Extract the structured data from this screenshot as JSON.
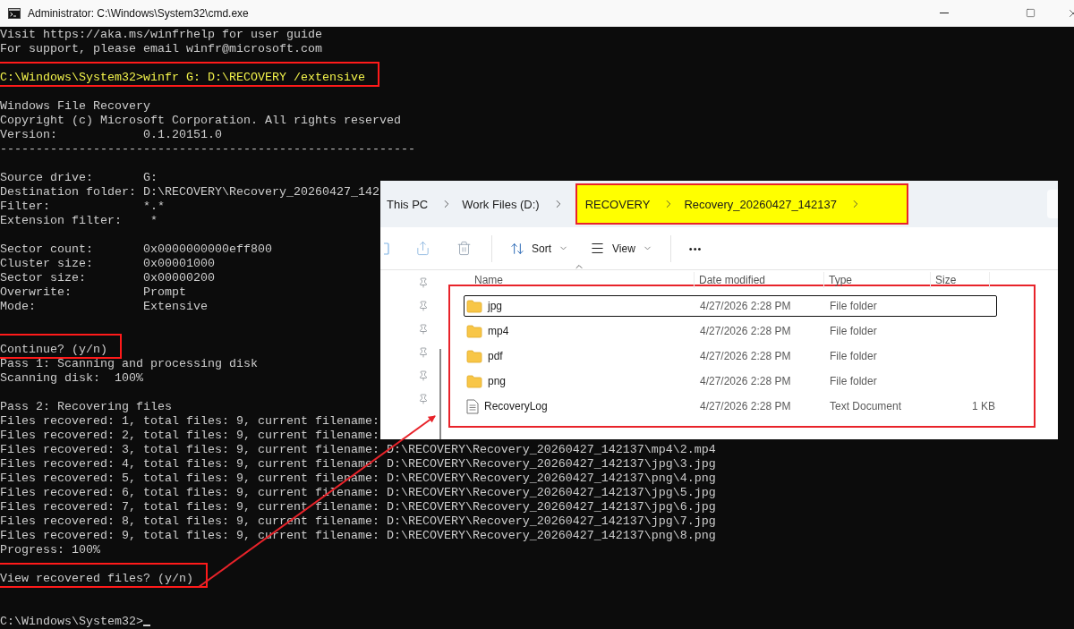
{
  "window": {
    "title": "Administrator: C:\\Windows\\System32\\cmd.exe"
  },
  "terminal": {
    "lines": [
      {
        "kind": "output",
        "text": "Visit https://aka.ms/winfrhelp for user guide",
        "boxed": false
      },
      {
        "kind": "output",
        "text": "For support, please email winfr@microsoft.com",
        "boxed": false
      },
      {
        "kind": "blank"
      },
      {
        "kind": "command",
        "text": "C:\\Windows\\System32>winfr G: D:\\RECOVERY /extensive",
        "boxed": true
      },
      {
        "kind": "blank"
      },
      {
        "kind": "output",
        "text": "Windows File Recovery",
        "boxed": false
      },
      {
        "kind": "output",
        "text": "Copyright (c) Microsoft Corporation. All rights reserved",
        "boxed": false
      },
      {
        "kind": "output",
        "text": "Version:            0.1.20151.0",
        "boxed": false
      },
      {
        "kind": "output",
        "text": "----------------------------------------------------------",
        "boxed": false
      },
      {
        "kind": "blank"
      },
      {
        "kind": "output",
        "text": "Source drive:       G:",
        "boxed": false
      },
      {
        "kind": "output",
        "text": "Destination folder: D:\\RECOVERY\\Recovery_20260427_142",
        "boxed": false
      },
      {
        "kind": "output",
        "text": "Filter:             *.*",
        "boxed": false
      },
      {
        "kind": "output",
        "text": "Extension filter:    *",
        "boxed": false
      },
      {
        "kind": "blank"
      },
      {
        "kind": "output",
        "text": "Sector count:       0x0000000000eff800",
        "boxed": false
      },
      {
        "kind": "output",
        "text": "Cluster size:       0x00001000",
        "boxed": false
      },
      {
        "kind": "output",
        "text": "Sector size:        0x00000200",
        "boxed": false
      },
      {
        "kind": "output",
        "text": "Overwrite:          Prompt",
        "boxed": false
      },
      {
        "kind": "output",
        "text": "Mode:               Extensive",
        "boxed": false
      },
      {
        "kind": "blank"
      },
      {
        "kind": "blank"
      },
      {
        "kind": "output",
        "text": "Continue? (y/n)",
        "boxed": true
      },
      {
        "kind": "output",
        "text": "Pass 1: Scanning and processing disk",
        "boxed": false
      },
      {
        "kind": "output",
        "text": "Scanning disk:  100%",
        "boxed": false
      },
      {
        "kind": "blank"
      },
      {
        "kind": "output",
        "text": "Pass 2: Recovering files",
        "boxed": false
      },
      {
        "kind": "output",
        "text": "Files recovered: 1, total files: 9, current filename:",
        "boxed": false
      },
      {
        "kind": "output",
        "text": "Files recovered: 2, total files: 9, current filename:",
        "boxed": false
      },
      {
        "kind": "output",
        "text": "Files recovered: 3, total files: 9, current filename: D:\\RECOVERY\\Recovery_20260427_142137\\mp4\\2.mp4",
        "boxed": false
      },
      {
        "kind": "output",
        "text": "Files recovered: 4, total files: 9, current filename: D:\\RECOVERY\\Recovery_20260427_142137\\jpg\\3.jpg",
        "boxed": false
      },
      {
        "kind": "output",
        "text": "Files recovered: 5, total files: 9, current filename: D:\\RECOVERY\\Recovery_20260427_142137\\png\\4.png",
        "boxed": false
      },
      {
        "kind": "output",
        "text": "Files recovered: 6, total files: 9, current filename: D:\\RECOVERY\\Recovery_20260427_142137\\jpg\\5.jpg",
        "boxed": false
      },
      {
        "kind": "output",
        "text": "Files recovered: 7, total files: 9, current filename: D:\\RECOVERY\\Recovery_20260427_142137\\jpg\\6.jpg",
        "boxed": false
      },
      {
        "kind": "output",
        "text": "Files recovered: 8, total files: 9, current filename: D:\\RECOVERY\\Recovery_20260427_142137\\jpg\\7.jpg",
        "boxed": false
      },
      {
        "kind": "output",
        "text": "Files recovered: 9, total files: 9, current filename: D:\\RECOVERY\\Recovery_20260427_142137\\png\\8.png",
        "boxed": false
      },
      {
        "kind": "output",
        "text": "Progress: 100%",
        "boxed": false
      },
      {
        "kind": "blank"
      },
      {
        "kind": "output",
        "text": "View recovered files? (y/n)",
        "boxed": true
      },
      {
        "kind": "blank"
      },
      {
        "kind": "blank"
      },
      {
        "kind": "prompt",
        "text": "C:\\Windows\\System32>",
        "boxed": false
      }
    ]
  },
  "explorer": {
    "breadcrumb": [
      {
        "label": "This PC",
        "highlighted": false
      },
      {
        "label": "Work Files (D:)",
        "highlighted": false
      },
      {
        "label": "RECOVERY",
        "highlighted": true
      },
      {
        "label": "Recovery_20260427_142137",
        "highlighted": true
      }
    ],
    "toolbar": {
      "sort": "Sort",
      "view": "View",
      "more": "•••"
    },
    "columns": [
      {
        "label": "Name",
        "sorted": true
      },
      {
        "label": "Date modified",
        "sorted": false
      },
      {
        "label": "Type",
        "sorted": false
      },
      {
        "label": "Size",
        "sorted": false
      }
    ],
    "rows_boxed": true,
    "rows": [
      {
        "kind": "folder",
        "name": "jpg",
        "date": "4/27/2026 2:28 PM",
        "type": "File folder",
        "selected": true
      },
      {
        "kind": "folder",
        "name": "mp4",
        "date": "4/27/2026 2:28 PM",
        "type": "File folder",
        "selected": false
      },
      {
        "kind": "folder",
        "name": "pdf",
        "date": "4/27/2026 2:28 PM",
        "type": "File folder",
        "selected": false
      },
      {
        "kind": "folder",
        "name": "png",
        "date": "4/27/2026 2:28 PM",
        "type": "File folder",
        "selected": false
      },
      {
        "kind": "text_file",
        "name": "RecoveryLog",
        "date": "4/27/2026 2:28 PM",
        "type": "Text Document",
        "size": "1 KB",
        "selected": false
      }
    ]
  }
}
